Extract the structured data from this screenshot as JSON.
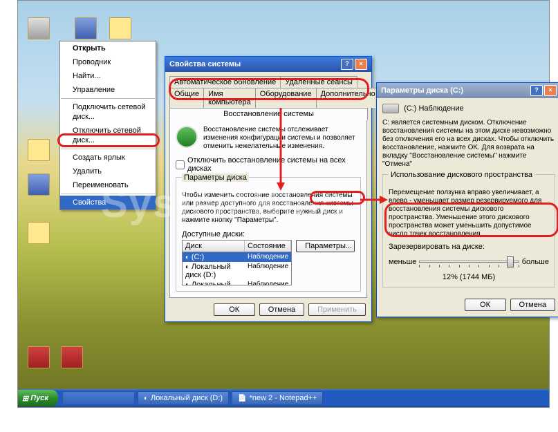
{
  "context_menu": {
    "open": "Открыть",
    "explorer": "Проводник",
    "find": "Найти...",
    "manage": "Управление",
    "map_drive": "Подключить сетевой диск...",
    "disconnect_drive": "Отключить сетевой диск...",
    "create_shortcut": "Создать ярлык",
    "delete": "Удалить",
    "rename": "Переименовать",
    "properties": "Свойства"
  },
  "sysprops": {
    "title": "Свойства системы",
    "tabs": {
      "auto_update": "Автоматическое обновление",
      "remote": "Удаленные сеансы",
      "general": "Общие",
      "computer_name": "Имя компьютера",
      "hardware": "Оборудование",
      "advanced": "Дополнительно",
      "system_restore": "Восстановление системы"
    },
    "info": "Восстановление системы отслеживает изменения конфигурации системы и позволяет отменить нежелательные изменения.",
    "disable_checkbox": "Отключить восстановление системы на всех дисках",
    "disk_params_title": "Параметры диска",
    "disk_params_text": "Чтобы изменить состояние восстановления системы или размер доступного для восстановления системы дискового пространства, выберите нужный диск и нажмите кнопку \"Параметры\".",
    "available_disks": "Доступные диски:",
    "col_disk": "Диск",
    "col_status": "Состояние",
    "params_btn": "Параметры...",
    "rows": [
      {
        "disk": "(C:)",
        "status": "Наблюдение"
      },
      {
        "disk": "Локальный диск (D:)",
        "status": "Наблюдение"
      },
      {
        "disk": "Локальный диск (E:)",
        "status": "Наблюдение"
      }
    ],
    "ok": "ОК",
    "cancel": "Отмена",
    "apply": "Применить"
  },
  "diskparams": {
    "title": "Параметры диска (C:)",
    "label": "(C:) Наблюдение",
    "warning": "C: является системным диском. Отключение восстановления системы на этом диске невозможно без отключения его на всех дисках. Чтобы отключить восстановление, нажмите OK. Для возврата на вкладку \"Восстановление системы\" нажмите \"Отмена\"",
    "usage_title": "Использование дискового пространства",
    "usage_text": "Перемещение ползунка вправо увеличивает, а влево - уменьшает размер резервируемого для восстановления системы дискового пространства. Уменьшение этого дискового пространства может уменьшить допустимое число точек восстановления.",
    "reserve_label": "Зарезервировать на диске:",
    "less": "меньше",
    "more": "больше",
    "value": "12% (1744 МБ)",
    "ok": "ОК",
    "cancel": "Отмена"
  },
  "taskbar": {
    "start": "Пуск",
    "task1": "Локальный диск (D:)",
    "task2": "*new  2 - Notepad++"
  },
  "watermark": "SystemBlog"
}
